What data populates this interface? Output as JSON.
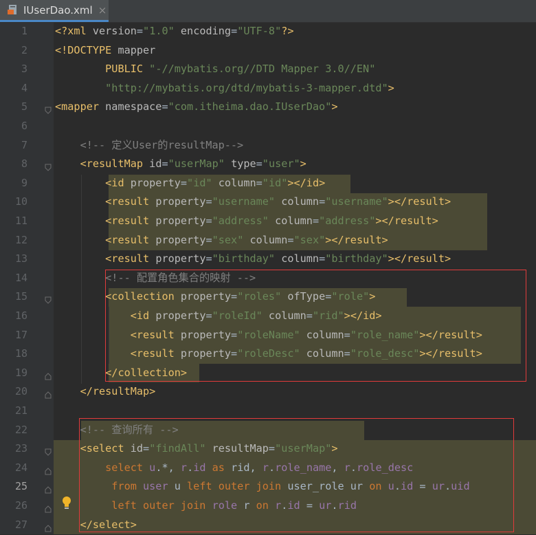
{
  "tab": {
    "filename": "IUserDao.xml",
    "close": "×",
    "icon": "xml-file-icon"
  },
  "editor": {
    "line_numbers": [
      "1",
      "2",
      "3",
      "4",
      "5",
      "6",
      "7",
      "8",
      "9",
      "10",
      "11",
      "12",
      "13",
      "14",
      "15",
      "16",
      "17",
      "18",
      "19",
      "20",
      "21",
      "22",
      "23",
      "24",
      "25",
      "26",
      "27"
    ],
    "current_line": "25",
    "lines": [
      [
        [
          "t",
          "<?xml "
        ],
        [
          "a",
          "version"
        ],
        [
          "p",
          "="
        ],
        [
          "v",
          "\"1.0\""
        ],
        [
          "a",
          " encoding"
        ],
        [
          "p",
          "="
        ],
        [
          "v",
          "\"UTF-8\""
        ],
        [
          "t",
          "?>"
        ]
      ],
      [
        [
          "t",
          "<!DOCTYPE "
        ],
        [
          "a",
          "mapper"
        ]
      ],
      [
        [
          "p",
          "        "
        ],
        [
          "t",
          "PUBLIC "
        ],
        [
          "v",
          "\"-//mybatis.org//DTD Mapper 3.0//EN\""
        ]
      ],
      [
        [
          "p",
          "        "
        ],
        [
          "v",
          "\"http://mybatis.org/dtd/mybatis-3-mapper.dtd\""
        ],
        [
          "t",
          ">"
        ]
      ],
      [
        [
          "t",
          "<mapper "
        ],
        [
          "a",
          "namespace"
        ],
        [
          "p",
          "="
        ],
        [
          "v",
          "\"com.itheima.dao.IUserDao\""
        ],
        [
          "t",
          ">"
        ]
      ],
      [],
      [
        [
          "p",
          "    "
        ],
        [
          "c",
          "<!-- 定义User的resultMap-->"
        ]
      ],
      [
        [
          "p",
          "    "
        ],
        [
          "t",
          "<resultMap "
        ],
        [
          "a",
          "id"
        ],
        [
          "p",
          "="
        ],
        [
          "v",
          "\"userMap\""
        ],
        [
          "a",
          " type"
        ],
        [
          "p",
          "="
        ],
        [
          "v",
          "\"user\""
        ],
        [
          "t",
          ">"
        ]
      ],
      [
        [
          "p",
          "        "
        ],
        [
          "t",
          "<id "
        ],
        [
          "a",
          "property"
        ],
        [
          "p",
          "="
        ],
        [
          "v",
          "\"id\""
        ],
        [
          "a",
          " column"
        ],
        [
          "p",
          "="
        ],
        [
          "v",
          "\"id\""
        ],
        [
          "t",
          "></id>"
        ]
      ],
      [
        [
          "p",
          "        "
        ],
        [
          "t",
          "<result "
        ],
        [
          "a",
          "property"
        ],
        [
          "p",
          "="
        ],
        [
          "v",
          "\"username\""
        ],
        [
          "a",
          " column"
        ],
        [
          "p",
          "="
        ],
        [
          "v",
          "\"username\""
        ],
        [
          "t",
          "></result>"
        ]
      ],
      [
        [
          "p",
          "        "
        ],
        [
          "t",
          "<result "
        ],
        [
          "a",
          "property"
        ],
        [
          "p",
          "="
        ],
        [
          "v",
          "\"address\""
        ],
        [
          "a",
          " column"
        ],
        [
          "p",
          "="
        ],
        [
          "v",
          "\"address\""
        ],
        [
          "t",
          "></result>"
        ]
      ],
      [
        [
          "p",
          "        "
        ],
        [
          "t",
          "<result "
        ],
        [
          "a",
          "property"
        ],
        [
          "p",
          "="
        ],
        [
          "v",
          "\"sex\""
        ],
        [
          "a",
          " column"
        ],
        [
          "p",
          "="
        ],
        [
          "v",
          "\"sex\""
        ],
        [
          "t",
          "></result>"
        ]
      ],
      [
        [
          "p",
          "        "
        ],
        [
          "t",
          "<result "
        ],
        [
          "a",
          "property"
        ],
        [
          "p",
          "="
        ],
        [
          "v",
          "\"birthday\""
        ],
        [
          "a",
          " column"
        ],
        [
          "p",
          "="
        ],
        [
          "v",
          "\"birthday\""
        ],
        [
          "t",
          "></result>"
        ]
      ],
      [
        [
          "p",
          "        "
        ],
        [
          "c",
          "<!-- 配置角色集合的映射 -->"
        ]
      ],
      [
        [
          "p",
          "        "
        ],
        [
          "t",
          "<collection "
        ],
        [
          "a",
          "property"
        ],
        [
          "p",
          "="
        ],
        [
          "v",
          "\"roles\""
        ],
        [
          "a",
          " ofType"
        ],
        [
          "p",
          "="
        ],
        [
          "v",
          "\"role\""
        ],
        [
          "t",
          ">"
        ]
      ],
      [
        [
          "p",
          "            "
        ],
        [
          "t",
          "<id "
        ],
        [
          "a",
          "property"
        ],
        [
          "p",
          "="
        ],
        [
          "v",
          "\"roleId\""
        ],
        [
          "a",
          " column"
        ],
        [
          "p",
          "="
        ],
        [
          "v",
          "\"rid\""
        ],
        [
          "t",
          "></id>"
        ]
      ],
      [
        [
          "p",
          "            "
        ],
        [
          "t",
          "<result "
        ],
        [
          "a",
          "property"
        ],
        [
          "p",
          "="
        ],
        [
          "v",
          "\"roleName\""
        ],
        [
          "a",
          " column"
        ],
        [
          "p",
          "="
        ],
        [
          "v",
          "\"role_name\""
        ],
        [
          "t",
          "></result>"
        ]
      ],
      [
        [
          "p",
          "            "
        ],
        [
          "t",
          "<result "
        ],
        [
          "a",
          "property"
        ],
        [
          "p",
          "="
        ],
        [
          "v",
          "\"roleDesc\""
        ],
        [
          "a",
          " column"
        ],
        [
          "p",
          "="
        ],
        [
          "v",
          "\"role_desc\""
        ],
        [
          "t",
          "></result>"
        ]
      ],
      [
        [
          "p",
          "        "
        ],
        [
          "t",
          "</collection>"
        ]
      ],
      [
        [
          "p",
          "    "
        ],
        [
          "t",
          "</resultMap>"
        ]
      ],
      [],
      [
        [
          "p",
          "    "
        ],
        [
          "c",
          "<!-- 查询所有 -->"
        ]
      ],
      [
        [
          "p",
          "    "
        ],
        [
          "t",
          "<select "
        ],
        [
          "a",
          "id"
        ],
        [
          "p",
          "="
        ],
        [
          "v",
          "\"findAll\""
        ],
        [
          "a",
          " resultMap"
        ],
        [
          "p",
          "="
        ],
        [
          "v",
          "\"userMap\""
        ],
        [
          "t",
          ">"
        ]
      ],
      [
        [
          "p",
          "        "
        ],
        [
          "k",
          "select "
        ],
        [
          "f",
          "u"
        ],
        [
          "p",
          ".*, "
        ],
        [
          "f",
          "r"
        ],
        [
          "p",
          "."
        ],
        [
          "f",
          "id"
        ],
        [
          "k",
          " as "
        ],
        [
          "p",
          "rid, "
        ],
        [
          "f",
          "r"
        ],
        [
          "p",
          "."
        ],
        [
          "f",
          "role_name"
        ],
        [
          "p",
          ", "
        ],
        [
          "f",
          "r"
        ],
        [
          "p",
          "."
        ],
        [
          "f",
          "role_desc"
        ]
      ],
      [
        [
          "p",
          "         "
        ],
        [
          "k",
          "from "
        ],
        [
          "f",
          "user "
        ],
        [
          "p",
          "u "
        ],
        [
          "k",
          "left outer join "
        ],
        [
          "p",
          "user_role ur "
        ],
        [
          "k",
          "on "
        ],
        [
          "f",
          "u"
        ],
        [
          "p",
          "."
        ],
        [
          "f",
          "id"
        ],
        [
          "p",
          " = "
        ],
        [
          "f",
          "ur"
        ],
        [
          "p",
          "."
        ],
        [
          "f",
          "uid"
        ]
      ],
      [
        [
          "p",
          "         "
        ],
        [
          "k",
          "left outer join "
        ],
        [
          "f",
          "role "
        ],
        [
          "p",
          "r "
        ],
        [
          "k",
          "on "
        ],
        [
          "f",
          "r"
        ],
        [
          "p",
          "."
        ],
        [
          "f",
          "id"
        ],
        [
          "p",
          " = "
        ],
        [
          "f",
          "ur"
        ],
        [
          "p",
          "."
        ],
        [
          "f",
          "rid"
        ]
      ],
      [
        [
          "p",
          "    "
        ],
        [
          "t",
          "</select>"
        ]
      ]
    ]
  },
  "colors": {
    "background": "#2b2b2b",
    "gutter": "#313335",
    "highlight": "#4b4a35",
    "annotation_box": "#e23b3b",
    "tag": "#e8bf6a",
    "attribute": "#bababa",
    "string": "#6a8759",
    "comment": "#808080",
    "keyword": "#cc7832"
  },
  "icons": {
    "intention": "lightbulb-icon",
    "fold": "fold-marker-icon"
  }
}
